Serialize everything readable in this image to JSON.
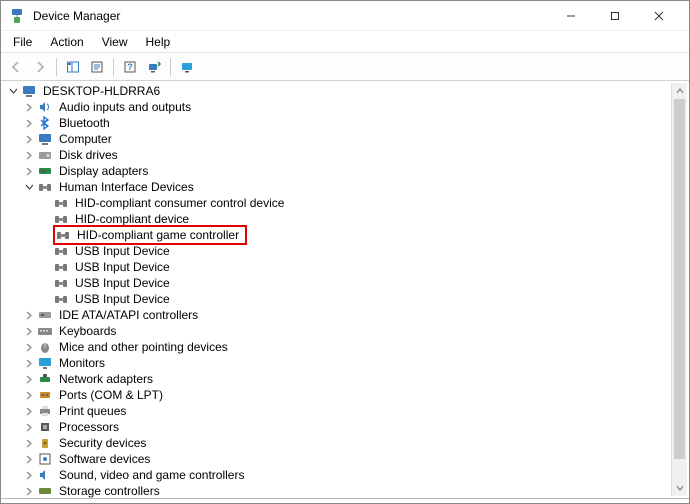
{
  "window": {
    "title": "Device Manager"
  },
  "menu": {
    "file": "File",
    "action": "Action",
    "view": "View",
    "help": "Help"
  },
  "tree": {
    "root": "DESKTOP-HLDRRA6",
    "audio": "Audio inputs and outputs",
    "bluetooth": "Bluetooth",
    "computer": "Computer",
    "disk": "Disk drives",
    "display": "Display adapters",
    "hid": "Human Interface Devices",
    "hid_children": {
      "c0": "HID-compliant consumer control device",
      "c1": "HID-compliant device",
      "c2": "HID-compliant game controller",
      "c3": "USB Input Device",
      "c4": "USB Input Device",
      "c5": "USB Input Device",
      "c6": "USB Input Device"
    },
    "ide": "IDE ATA/ATAPI controllers",
    "keyboards": "Keyboards",
    "mice": "Mice and other pointing devices",
    "monitors": "Monitors",
    "network": "Network adapters",
    "ports": "Ports (COM & LPT)",
    "printq": "Print queues",
    "processors": "Processors",
    "security": "Security devices",
    "software": "Software devices",
    "sound": "Sound, video and game controllers",
    "storage": "Storage controllers"
  }
}
